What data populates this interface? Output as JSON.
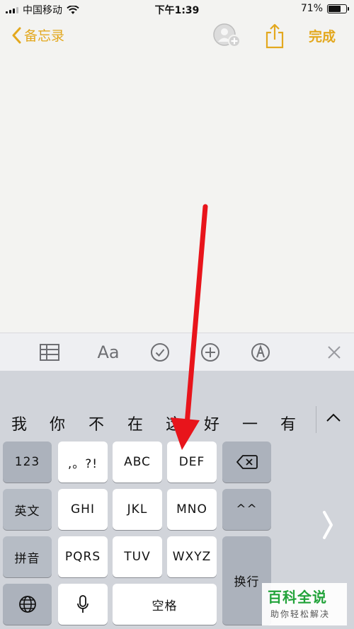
{
  "status_bar": {
    "carrier": "中国移动",
    "time": "下午1:39",
    "battery": "71%",
    "battery_level": 0.71
  },
  "nav": {
    "back_label": "备忘录",
    "done_label": "完成"
  },
  "toolbar": {
    "format_label": "Aa"
  },
  "candidates": [
    "我",
    "你",
    "不",
    "在",
    "这",
    "好",
    "一",
    "有"
  ],
  "keys": {
    "row1": [
      "123",
      ",。?!",
      "ABC",
      "DEF"
    ],
    "row2": [
      "英文",
      "GHI",
      "JKL",
      "MNO",
      "^^"
    ],
    "row3": [
      "拼音",
      "PQRS",
      "TUV",
      "WXYZ",
      "换行"
    ],
    "row4": {
      "space": "空格"
    }
  },
  "watermark": {
    "title": "百科全说",
    "subtitle": "助你轻松解决"
  },
  "colors": {
    "accent": "#e3a81e",
    "arrow": "#e8141b",
    "keyboard_bg": "#d1d4da",
    "watermark_green": "#22a33a"
  }
}
